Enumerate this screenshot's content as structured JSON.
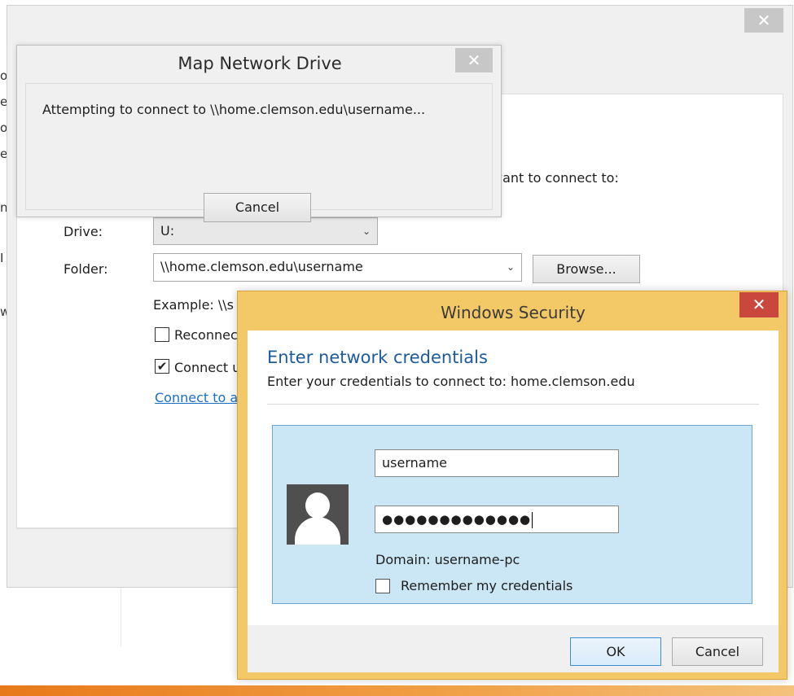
{
  "edge_fragments": [
    "or",
    "es",
    "ov",
    "ec",
    "n",
    "I",
    "w"
  ],
  "background_window": {
    "close_glyph": "✕",
    "instruction_fragment": "want to connect to:",
    "drive_label": "Drive:",
    "drive_value": "U:",
    "folder_label": "Folder:",
    "folder_value": "\\\\home.clemson.edu\\username",
    "browse_label": "Browse...",
    "example_fragment": "Example: \\\\s",
    "reconnect_fragment": "Reconnec",
    "connect_fragment": "Connect u",
    "link_fragment": "Connect to a",
    "dropdown_arrow": "⌄"
  },
  "progress_dialog": {
    "title": "Map Network Drive",
    "close_glyph": "✕",
    "message": "Attempting to connect to \\\\home.clemson.edu\\username...",
    "cancel_label": "Cancel"
  },
  "security_dialog": {
    "title": "Windows Security",
    "close_glyph": "✕",
    "heading": "Enter network credentials",
    "subtitle": "Enter your credentials to connect to: home.clemson.edu",
    "username_value": "username",
    "password_mask": "●●●●●●●●●●●●●",
    "domain_text": "Domain: username-pc",
    "remember_label": "Remember my credentials",
    "ok_label": "OK",
    "cancel_label": "Cancel"
  },
  "colors": {
    "security_frame": "#f3c867",
    "security_close": "#c9473c",
    "heading_blue": "#1c5c9e",
    "tile_blue": "#cbe6f4"
  }
}
